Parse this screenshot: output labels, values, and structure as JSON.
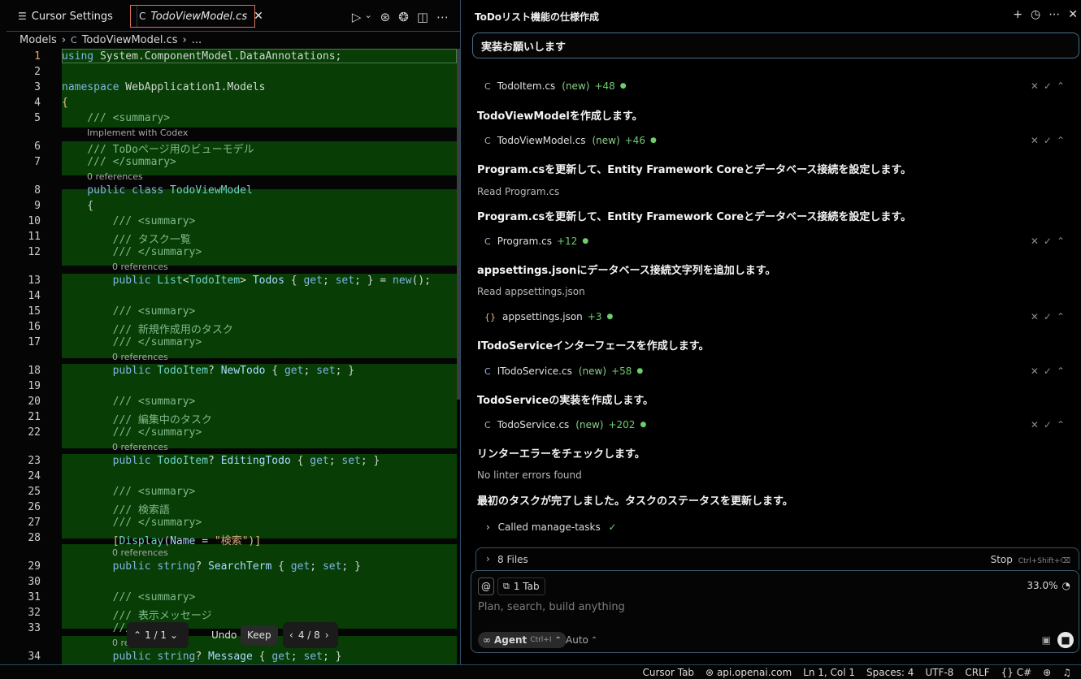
{
  "editor": {
    "tabs": [
      {
        "label": "Cursor Settings",
        "icon": "cursor-settings-icon"
      },
      {
        "label": "TodoViewModel.cs",
        "icon": "csharp-file-icon"
      }
    ],
    "breadcrumb": [
      "Models",
      "TodoViewModel.cs",
      "..."
    ],
    "lines": [
      {
        "n": "1"
      },
      {
        "n": "2"
      },
      {
        "n": "3"
      },
      {
        "n": "4"
      },
      {
        "n": "5"
      },
      {
        "n": "6"
      },
      {
        "n": "7"
      },
      {
        "n": "8"
      },
      {
        "n": "9"
      },
      {
        "n": "10"
      },
      {
        "n": "11"
      },
      {
        "n": "12"
      },
      {
        "n": "13"
      },
      {
        "n": "14"
      },
      {
        "n": "15"
      },
      {
        "n": "16"
      },
      {
        "n": "17"
      },
      {
        "n": "18"
      },
      {
        "n": "19"
      },
      {
        "n": "20"
      },
      {
        "n": "21"
      },
      {
        "n": "22"
      },
      {
        "n": "23"
      },
      {
        "n": "24"
      },
      {
        "n": "25"
      },
      {
        "n": "26"
      },
      {
        "n": "27"
      },
      {
        "n": "28"
      },
      {
        "n": "29"
      },
      {
        "n": "30"
      },
      {
        "n": "31"
      },
      {
        "n": "32"
      },
      {
        "n": "33"
      },
      {
        "n": "34"
      }
    ],
    "code": {
      "l1a": "using",
      "l1b": " System.ComponentModel.DataAnnotations;",
      "l3a": "namespace",
      "l3b": " WebApplication1.Models",
      "l4": "{",
      "l5": "    /// <summary>",
      "lens5": "Implement with Codex",
      "l6": "    /// ToDoページ用のビューモデル",
      "l7": "    /// </summary>",
      "lens7": "0 references",
      "l8a": "    public class",
      "l8b": " TodoViewModel",
      "l9": "    {",
      "l10": "        /// <summary>",
      "l11": "        /// タスク一覧",
      "l12": "        /// </summary>",
      "lens12": "0 references",
      "l13a": "        public",
      "l13b": " List",
      "l13c": "<",
      "l13d": "TodoItem",
      "l13e": ">",
      "l13f": " Todos",
      "l13g": " { ",
      "l13h": "get",
      "l13i": "; ",
      "l13j": "set",
      "l13k": "; } = ",
      "l13l": "new",
      "l13m": "();",
      "l15": "        /// <summary>",
      "l16": "        /// 新規作成用のタスク",
      "l17": "        /// </summary>",
      "lens17": "0 references",
      "l18a": "        public",
      "l18b": " TodoItem",
      "l18c": "? ",
      "l18d": "NewTodo",
      "l18e": " { ",
      "l18f": "get",
      "l18g": "; ",
      "l18h": "set",
      "l18i": "; }",
      "l20": "        /// <summary>",
      "l21": "        /// 編集中のタスク",
      "l22": "        /// </summary>",
      "lens22": "0 references",
      "l23a": "        public",
      "l23b": " TodoItem",
      "l23c": "? ",
      "l23d": "EditingTodo",
      "l23e": " { ",
      "l23f": "get",
      "l23g": "; ",
      "l23h": "set",
      "l23i": "; }",
      "l25": "        /// <summary>",
      "l26": "        /// 検索語",
      "l27": "        /// </summary>",
      "l28a": "        [",
      "l28b": "Display",
      "l28c": "(",
      "l28d": "Name",
      "l28e": " = ",
      "l28f": "\"検索\"",
      "l28g": ")]",
      "lens28": "0 references",
      "l29a": "        public",
      "l29b": " string",
      "l29c": "? ",
      "l29d": "SearchTerm",
      "l29e": " { ",
      "l29f": "get",
      "l29g": "; ",
      "l29h": "set",
      "l29i": "; }",
      "l31": "        /// <summary>",
      "l32": "        /// 表示メッセージ",
      "l33": "        ///",
      "lens33": "0 re",
      "l34a": "        public",
      "l34b": " string",
      "l34c": "? ",
      "l34d": "Message",
      "l34e": " { ",
      "l34f": "get",
      "l34g": "; ",
      "l34h": "set",
      "l34i": "; }"
    },
    "diff_toolbar": {
      "hunk": "1 / 1",
      "undo": "Undo",
      "keep": "Keep",
      "file_nav": "4 / 8"
    }
  },
  "chat": {
    "title": "ToDoリスト機能の仕様作成",
    "user_message": "実装お願いします",
    "files": [
      {
        "name": "TodoItem.cs",
        "new": "(new)",
        "plus": "+48"
      },
      {
        "name": "TodoViewModel.cs",
        "new": "(new)",
        "plus": "+46"
      },
      {
        "name": "Program.cs",
        "new": "",
        "plus": "+12"
      },
      {
        "name": "appsettings.json",
        "new": "",
        "plus": "+3"
      },
      {
        "name": "ITodoService.cs",
        "new": "(new)",
        "plus": "+58"
      },
      {
        "name": "TodoService.cs",
        "new": "(new)",
        "plus": "+202"
      }
    ],
    "messages": {
      "m1": "TodoViewModelを作成します。",
      "m2": "Program.csを更新して、Entity Framework Coreとデータベース接続を設定します。",
      "r1": "Read Program.cs",
      "m3": "Program.csを更新して、Entity Framework Coreとデータベース接続を設定します。",
      "m4": "appsettings.jsonにデータベース接続文字列を追加します。",
      "r2": "Read appsettings.json",
      "m5": "ITodoServiceインターフェースを作成します。",
      "m6": "TodoServiceの実装を作成します。",
      "m7": "リンターエラーをチェックします。",
      "r3": "No linter errors found",
      "m8": "最初のタスクが完了しました。タスクのステータスを更新します。"
    },
    "called": "Called manage-tasks",
    "files_bar": {
      "label": "8 Files",
      "stop": "Stop",
      "stop_shortcut": "Ctrl+Shift+⌫"
    },
    "composer": {
      "at": "@",
      "tab_chip": "1 Tab",
      "percent": "33.0%",
      "placeholder": "Plan, search, build anything",
      "agent": "Agent",
      "agent_shortcut": "Ctrl+I",
      "model": "Auto"
    }
  },
  "status": {
    "cursor_tab": "Cursor Tab",
    "api": "api.openai.com",
    "position": "Ln 1, Col 1",
    "spaces": "Spaces: 4",
    "encoding": "UTF-8",
    "eol": "CRLF",
    "language": "C#"
  }
}
